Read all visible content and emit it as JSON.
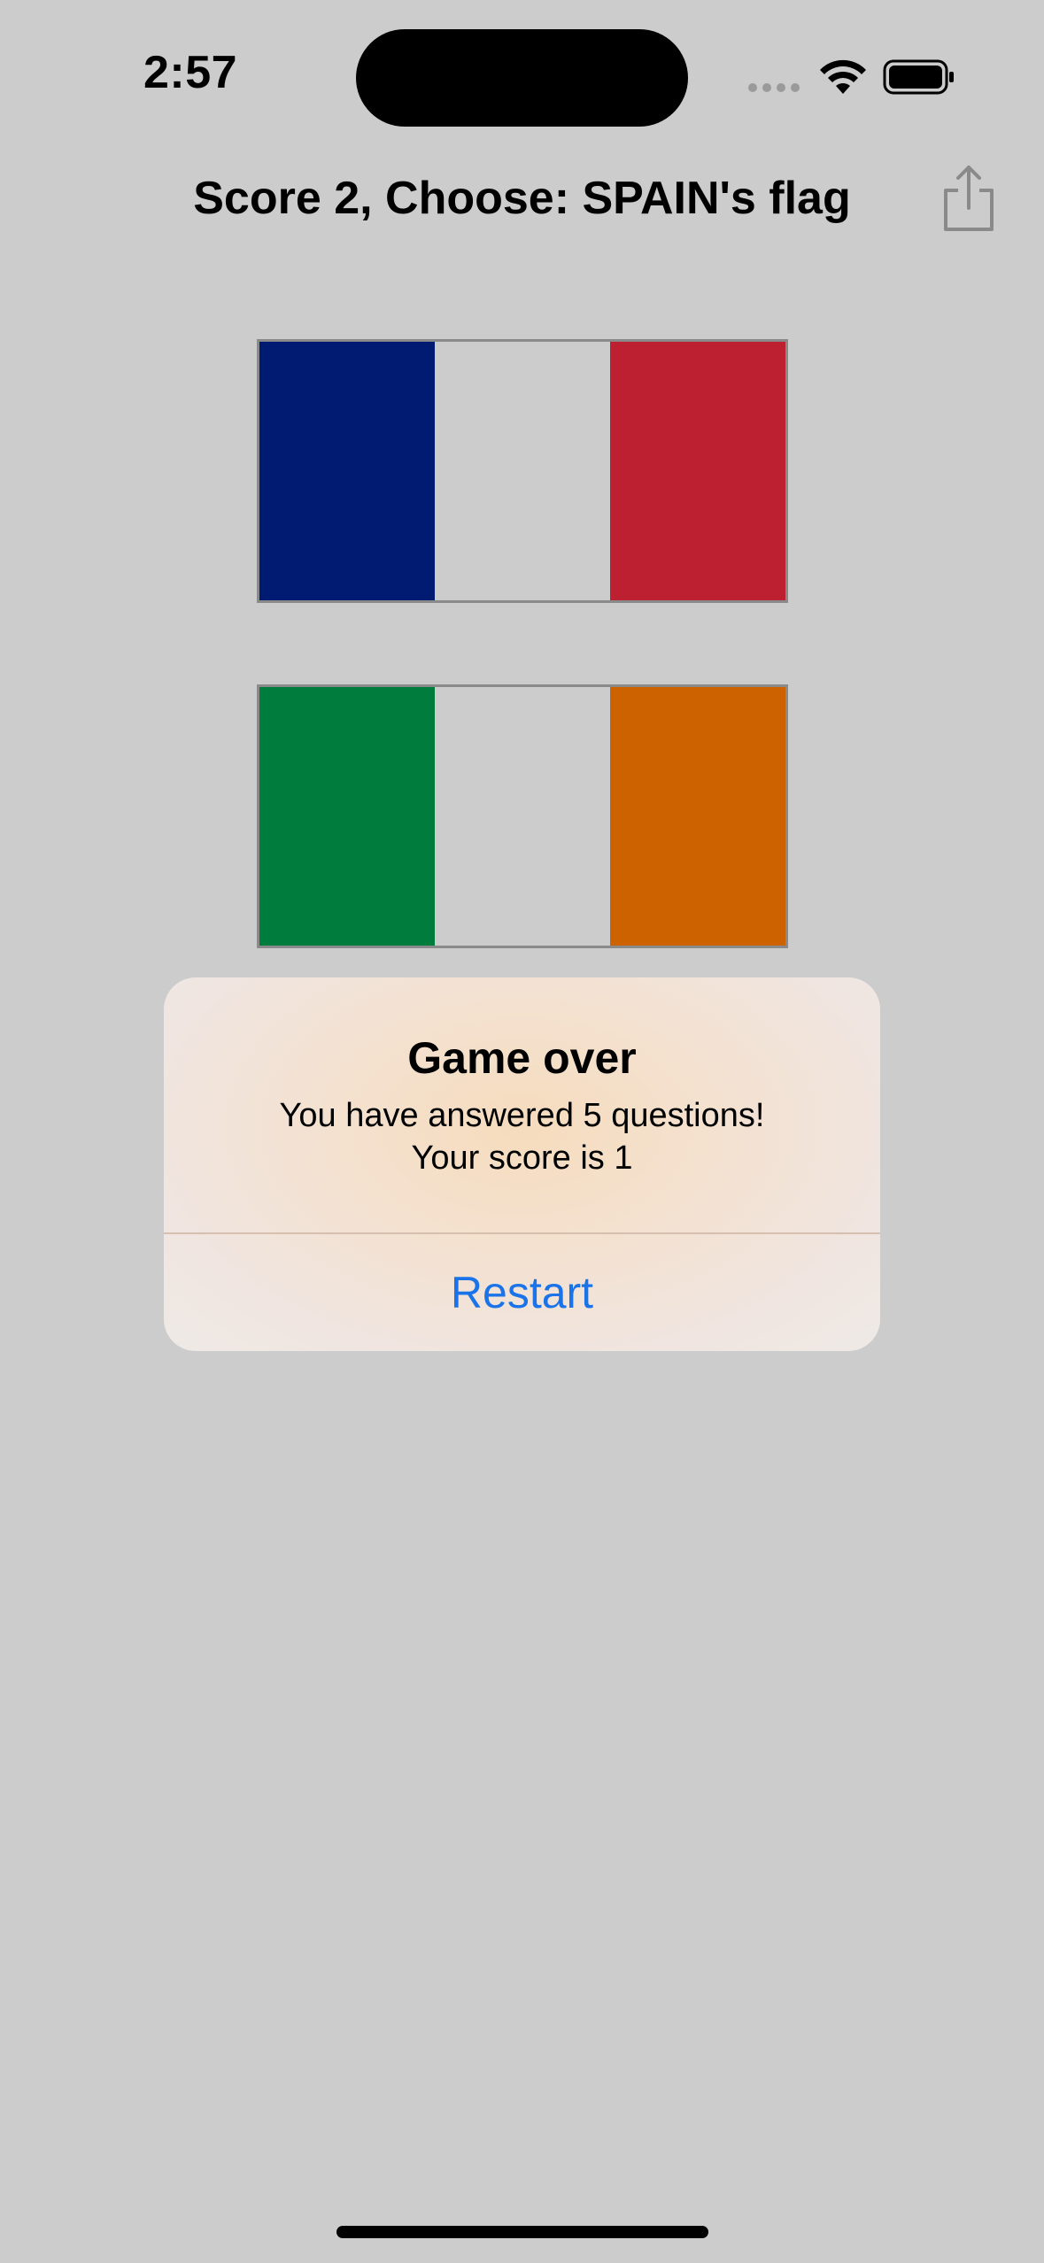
{
  "status_bar": {
    "time": "2:57"
  },
  "nav": {
    "title": "Score 2, Choose: SPAIN's flag",
    "share_icon": "share-icon"
  },
  "flags": [
    {
      "name": "france",
      "colors": [
        "#001b71",
        "#cccccc",
        "#bd2031"
      ]
    },
    {
      "name": "ireland",
      "colors": [
        "#007d3c",
        "#cccccc",
        "#cc6200"
      ]
    }
  ],
  "alert": {
    "title": "Game over",
    "message": "You have answered 5 questions!\nYour score is 1",
    "button_label": "Restart"
  },
  "colors": {
    "background": "#cccccc",
    "accent": "#1a73e8"
  }
}
